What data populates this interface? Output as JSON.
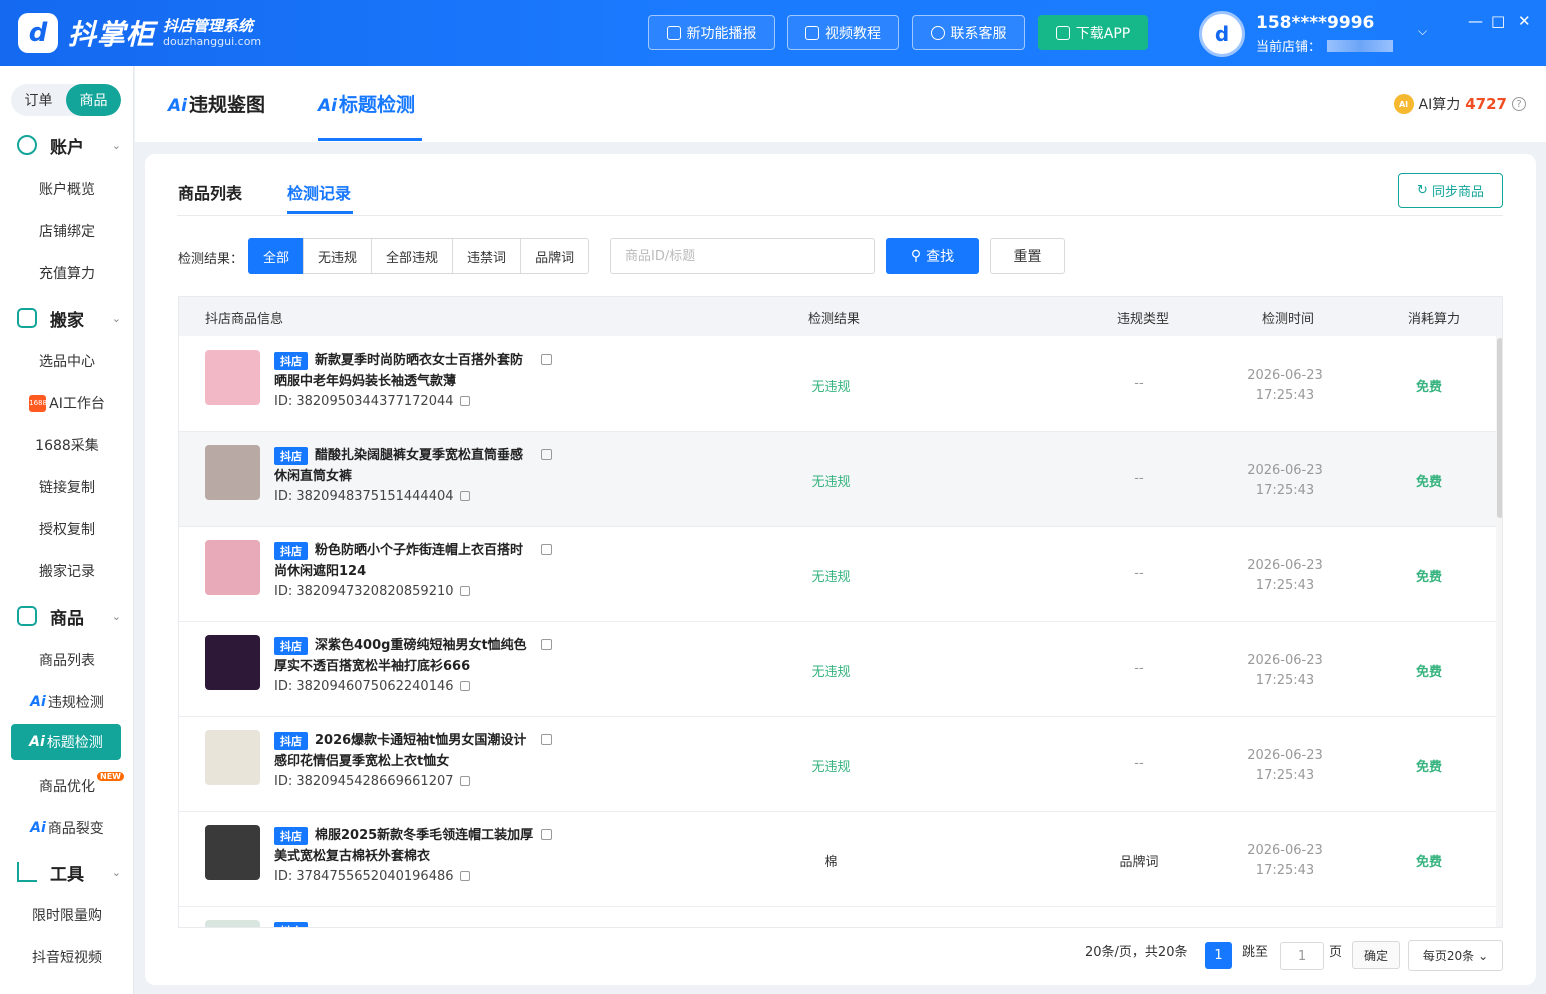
{
  "header": {
    "app_name": "抖掌柜",
    "subtitle": "抖店管理系统",
    "domain": "douzhanggui.com",
    "buttons": [
      "新功能播报",
      "视频教程",
      "联系客服",
      "下载APP"
    ],
    "user_phone": "158****9996",
    "shop_label": "当前店铺："
  },
  "sidebar": {
    "seg": [
      "订单",
      "商品"
    ],
    "groups": {
      "account": {
        "title": "账户",
        "items": [
          "账户概览",
          "店铺绑定",
          "充值算力"
        ]
      },
      "move": {
        "title": "搬家",
        "items": [
          "选品中心",
          "AI工作台",
          "1688采集",
          "链接复制",
          "授权复制",
          "搬家记录"
        ]
      },
      "product": {
        "title": "商品",
        "items": [
          "商品列表",
          "违规检测",
          "标题检测",
          "商品优化",
          "商品裂变"
        ]
      },
      "tools": {
        "title": "工具",
        "items": [
          "限时限量购",
          "抖音短视频"
        ]
      }
    },
    "ai_prefix": "Ai",
    "new_tag": "NEW",
    "badge_1688": "1688"
  },
  "top_tabs": [
    "违规鉴图",
    "标题检测"
  ],
  "ai_power": {
    "label": "AI算力",
    "value": "4727"
  },
  "content": {
    "tabs": [
      "商品列表",
      "检测记录"
    ],
    "sync_button": "同步商品",
    "filter_label": "检测结果：",
    "filters": [
      "全部",
      "无违规",
      "全部违规",
      "违禁词",
      "品牌词"
    ],
    "search_placeholder": "商品ID/标题",
    "search_button": "查找",
    "reset_button": "重置",
    "columns": [
      "抖店商品信息",
      "检测结果",
      "违规类型",
      "检测时间",
      "消耗算力"
    ],
    "store_tag": "抖店",
    "rows": [
      {
        "title": "新款夏季时尚防晒衣女士百搭外套防晒服中老年妈妈装长袖透气款薄",
        "id": "ID: 3820950344377172044",
        "result": "无违规",
        "type": "--",
        "date": "2026-06-23",
        "time": "17:25:43",
        "cost": "免费",
        "color": "#f2b8c6"
      },
      {
        "title": "醋酸扎染阔腿裤女夏季宽松直筒垂感休闲直筒女裤",
        "id": "ID: 3820948375151444404",
        "result": "无违规",
        "type": "--",
        "date": "2026-06-23",
        "time": "17:25:43",
        "cost": "免费",
        "color": "#b8a9a4"
      },
      {
        "title": "粉色防晒小个子炸街连帽上衣百搭时尚休闲遮阳124",
        "id": "ID: 3820947320820859210",
        "result": "无违规",
        "type": "--",
        "date": "2026-06-23",
        "time": "17:25:43",
        "cost": "免费",
        "color": "#e8a9b8"
      },
      {
        "title": "深紫色400g重磅纯短袖男女t恤纯色厚实不透百搭宽松半袖打底衫666",
        "id": "ID: 3820946075062240146",
        "result": "无违规",
        "type": "--",
        "date": "2026-06-23",
        "time": "17:25:43",
        "cost": "免费",
        "color": "#2d1838"
      },
      {
        "title": "2026爆款卡通短袖t恤男女国潮设计感印花情侣夏季宽松上衣t恤女",
        "id": "ID: 3820945428669661207",
        "result": "无违规",
        "type": "--",
        "date": "2026-06-23",
        "time": "17:25:43",
        "cost": "免费",
        "color": "#e9e4da"
      },
      {
        "title": "棉服2025新款冬季毛领连帽工装加厚美式宽松复古棉袄外套棉衣",
        "id": "ID: 3784755652040196486",
        "result": "棉",
        "type": "品牌词",
        "date": "2026-06-23",
        "time": "17:25:43",
        "cost": "免费",
        "color": "#3a3a3a"
      }
    ],
    "pagination": {
      "summary": "20条/页，共20条",
      "current": "1",
      "jump_label": "跳至",
      "page_unit": "页",
      "jump_value": "1",
      "confirm": "确定",
      "page_size": "每页20条"
    }
  }
}
